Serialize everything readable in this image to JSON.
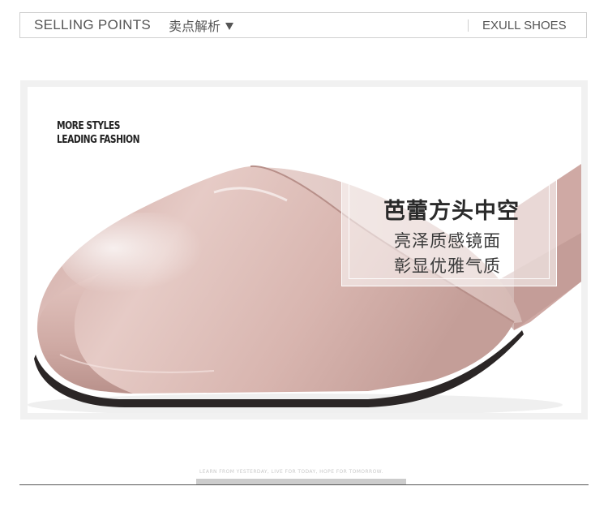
{
  "header": {
    "title_en": "SELLING POINTS",
    "title_cn": "卖点解析",
    "dropdown_icon": "triangle-down",
    "brand": "EXULL SHOES"
  },
  "product_image": {
    "tagline_line1": "MORE STYLES",
    "tagline_line2": "LEADING FASHION",
    "feature_title": "芭蕾方头中空",
    "feature_line1": "亮泽质感镜面",
    "feature_line2": "彰显优雅气质",
    "shoe_color": "#d9b8b2"
  },
  "footer": {
    "caption": "LEARN FROM YESTERDAY, LIVE FOR TODAY, HOPE FOR TOMORROW."
  }
}
